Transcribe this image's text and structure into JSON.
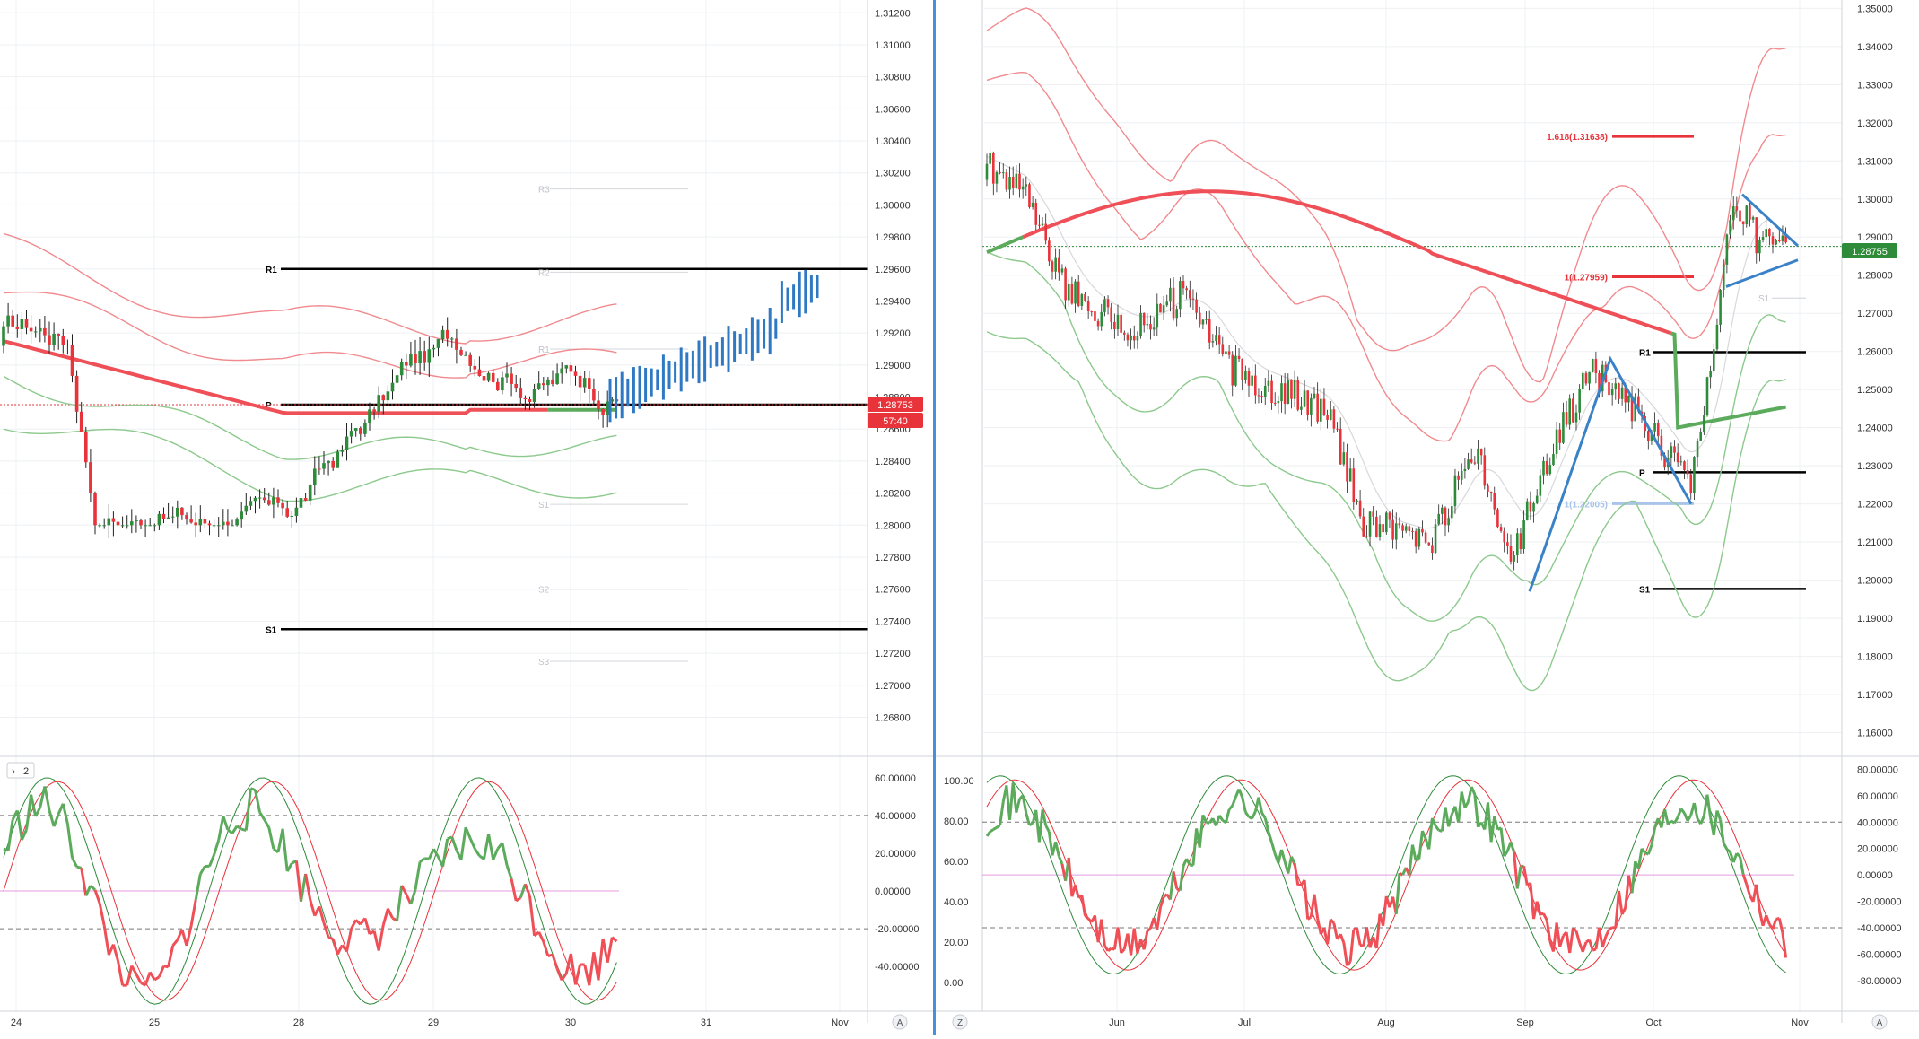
{
  "colors": {
    "bull": "#2e8b3a",
    "bear": "#e8333a",
    "ma_red": "#ef4f56",
    "ma_green": "#5cab5c",
    "band_red": "#f08a8e",
    "band_green": "#8cc98c",
    "blue": "#3a82c7",
    "grid": "#eef0f3",
    "axis_text": "#333333",
    "pivot_line": "#000000",
    "projection": "#2f78c4",
    "osc_pink": "#e59be0",
    "price_tag_red": "#e8333a",
    "price_tag_green": "#2e8b3a"
  },
  "chart_data": [
    {
      "type": "candlestick",
      "panel": "left",
      "y_ticks": [
        "1.31200",
        "1.31000",
        "1.30800",
        "1.30600",
        "1.30400",
        "1.30200",
        "1.30000",
        "1.29800",
        "1.29600",
        "1.29400",
        "1.29200",
        "1.29000",
        "1.28800",
        "1.28600",
        "1.28400",
        "1.28200",
        "1.28000",
        "1.27800",
        "1.27600",
        "1.27400",
        "1.27200",
        "1.27000",
        "1.26800"
      ],
      "ylim": [
        1.2664,
        1.3128
      ],
      "x_ticks": [
        "24",
        "25",
        "28",
        "29",
        "30",
        "31",
        "Nov"
      ],
      "last_price": "1.28753",
      "countdown": "57:40",
      "levels": [
        {
          "label": "R1",
          "value": 1.296
        },
        {
          "label": "P",
          "value": 1.28753
        },
        {
          "label": "S1",
          "value": 1.2735
        }
      ],
      "faint_levels": [
        {
          "label": "R3",
          "value": 1.301
        },
        {
          "label": "R2",
          "value": 1.2958
        },
        {
          "label": "R1",
          "value": 1.291
        },
        {
          "label": "S1",
          "value": 1.2813
        },
        {
          "label": "S2",
          "value": 1.276
        },
        {
          "label": "S3",
          "value": 1.2715
        }
      ],
      "oscillator": {
        "badge": "2",
        "y_ticks": [
          "60.00000",
          "40.00000",
          "20.00000",
          "0.00000",
          "-20.00000",
          "-40.00000"
        ],
        "ylim": [
          -58,
          68
        ],
        "dashed_levels": [
          40,
          -20
        ],
        "pink_level": 0
      }
    },
    {
      "type": "candlestick",
      "panel": "right",
      "y_ticks": [
        "1.35000",
        "1.34000",
        "1.33000",
        "1.32000",
        "1.31000",
        "1.30000",
        "1.29000",
        "1.28000",
        "1.27000",
        "1.26000",
        "1.25000",
        "1.24000",
        "1.23000",
        "1.22000",
        "1.21000",
        "1.20000",
        "1.19000",
        "1.18000",
        "1.17000",
        "1.16000"
      ],
      "ylim": [
        1.1573,
        1.3522
      ],
      "x_ticks": [
        "Jun",
        "Jul",
        "Aug",
        "Sep",
        "Oct",
        "Nov"
      ],
      "last_price": "1.28755",
      "levels": [
        {
          "label": "R1",
          "value": 1.2598
        },
        {
          "label": "P",
          "value": 1.2283
        },
        {
          "label": "S1",
          "value": 1.1977
        }
      ],
      "faint_levels": [
        {
          "label": "S1",
          "value": 1.274
        }
      ],
      "fibonacci": [
        {
          "label": "1.618(1.31638)",
          "value": 1.31638,
          "color": "#e8333a"
        },
        {
          "label": "1(1.27959)",
          "value": 1.27959,
          "color": "#e8333a"
        },
        {
          "label": "1(1.22005)",
          "value": 1.22005,
          "color": "#a8c4ea"
        }
      ],
      "oscillator_left_axis": [
        "100.00",
        "80.00",
        "60.00",
        "40.00",
        "20.00",
        "0.00"
      ],
      "oscillator_right_axis": [
        "80.00000",
        "60.00000",
        "40.00000",
        "20.00000",
        "0.00000",
        "-20.00000",
        "-40.00000",
        "-60.00000",
        "-80.00000"
      ],
      "oscillator": {
        "ylim": [
          -95,
          85
        ],
        "dashed_levels": [
          40,
          -40
        ],
        "pink_level": 0
      }
    }
  ],
  "ui": {
    "left_axis_label": "A",
    "right_axis_label": "A",
    "z_label": "Z"
  }
}
